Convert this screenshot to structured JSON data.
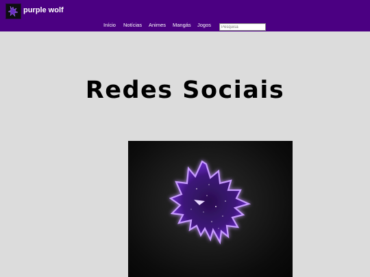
{
  "header": {
    "brand": "purple wolf",
    "logo_icon": "wolf-logo-icon",
    "background_color": "#4b0082"
  },
  "nav": {
    "items": [
      "Início",
      "Notícias",
      "Animes",
      "Mangás",
      "Jogos"
    ]
  },
  "search": {
    "placeholder": "Pesquisa"
  },
  "main": {
    "heading": "Redes Sociais",
    "image_icon": "purple-wolf-image"
  },
  "colors": {
    "page_background": "#dcdcdc",
    "accent": "#8a2be2"
  }
}
